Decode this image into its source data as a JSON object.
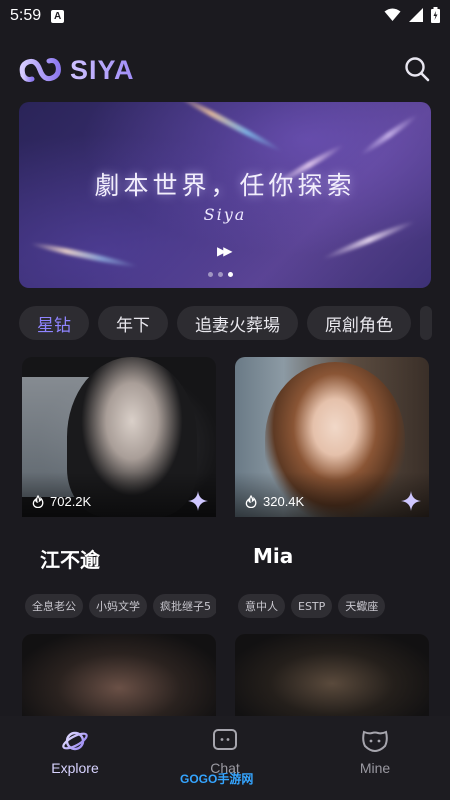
{
  "status_bar": {
    "time": "5:59",
    "notification_badge": "A"
  },
  "header": {
    "app_name": "SIYA"
  },
  "banner": {
    "title": "劇本世界，任你探索",
    "subtitle": "Siya",
    "page_count": 3,
    "active_page": 3
  },
  "tags": [
    {
      "label": "星钻",
      "active": true
    },
    {
      "label": "年下",
      "active": false
    },
    {
      "label": "追妻火葬場",
      "active": false
    },
    {
      "label": "原創角色",
      "active": false
    }
  ],
  "cards": [
    {
      "name": "江不逾",
      "likes": "702.2K",
      "tags": [
        "全息老公",
        "小妈文学",
        "疯批继子5"
      ]
    },
    {
      "name": "Mia",
      "likes": "320.4K",
      "tags": [
        "意中人",
        "ESTP",
        "天蠍座"
      ]
    }
  ],
  "nav": {
    "items": [
      {
        "label": "Explore",
        "active": true
      },
      {
        "label": "Chat",
        "active": false
      },
      {
        "label": "Mine",
        "active": false
      }
    ]
  },
  "watermark": "GOGO手游网",
  "colors": {
    "accent": "#8f84ff",
    "background": "#1b1a1f",
    "tag_bg": "#2d2c31"
  }
}
